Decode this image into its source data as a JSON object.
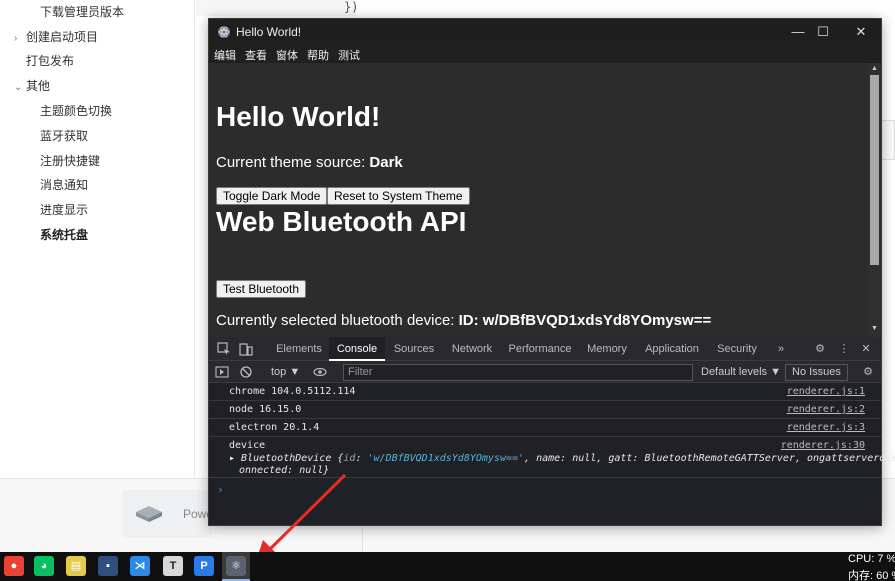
{
  "background": {
    "sidebar_items": [
      {
        "label": "下载管理员版本",
        "indent": 2,
        "caret": ""
      },
      {
        "label": "创建启动项目",
        "indent": 1,
        "caret": "›"
      },
      {
        "label": "打包发布",
        "indent": 1,
        "caret": ""
      },
      {
        "label": "其他",
        "indent": 1,
        "caret": "⌄"
      },
      {
        "label": "主题颜色切换",
        "indent": 2,
        "caret": ""
      },
      {
        "label": "蓝牙获取",
        "indent": 2,
        "caret": ""
      },
      {
        "label": "注册快捷键",
        "indent": 2,
        "caret": ""
      },
      {
        "label": "消息通知",
        "indent": 2,
        "caret": ""
      },
      {
        "label": "进度显示",
        "indent": 2,
        "caret": ""
      },
      {
        "label": "系统托盘",
        "indent": 2,
        "caret": "",
        "bold": true
      }
    ],
    "code_snippet": "})",
    "power_label": "Powe"
  },
  "window": {
    "title": "Hello World!",
    "controls": {
      "minimize": "—",
      "maximize": "☐",
      "close": "✕"
    },
    "menu": [
      "编辑",
      "查看",
      "窗体",
      "帮助",
      "测试"
    ],
    "content": {
      "heading1": "Hello World!",
      "theme_source_label": "Current theme source: ",
      "theme_source_value": "Dark",
      "toggle_button": "Toggle Dark Mode",
      "reset_button": "Reset to System Theme",
      "heading2": "Web Bluetooth API",
      "test_button": "Test Bluetooth",
      "device_label": "Currently selected bluetooth device: ",
      "device_value": "ID: w/DBfBVQD1xdsYd8YOmysw=="
    }
  },
  "devtools": {
    "tabs": [
      "Elements",
      "Console",
      "Sources",
      "Network",
      "Performance",
      "Memory",
      "Application",
      "Security"
    ],
    "active_tab": "Console",
    "more": "»",
    "context": "top ▼",
    "filter_placeholder": "Filter",
    "levels": "Default levels ▼",
    "issues": "No Issues",
    "logs": [
      {
        "text": "chrome 104.0.5112.114",
        "source": "renderer.js:1"
      },
      {
        "text": "node 16.15.0",
        "source": "renderer.js:2"
      },
      {
        "text": "electron 20.1.4",
        "source": "renderer.js:3"
      },
      {
        "text": "device",
        "source": "renderer.js:30"
      }
    ],
    "object": {
      "type": "BluetoothDevice",
      "id_key": "id",
      "id_value": "'w/DBfBVQD1xdsYd8YOmysw=='",
      "rest_line1": ", name: null, gatt: BluetoothRemoteGATTServer, ongattserverdisc",
      "rest_line2": "onnected: null}"
    },
    "prompt": "›"
  },
  "taskbar": {
    "apps": [
      {
        "name": "chrome-icon",
        "color": "#ea4335",
        "glyph": "●"
      },
      {
        "name": "wechat-icon",
        "color": "#07c160",
        "glyph": "◕"
      },
      {
        "name": "notepad-icon",
        "color": "#e6c84a",
        "glyph": "▤"
      },
      {
        "name": "app-icon",
        "color": "#2f4f7f",
        "glyph": "▪"
      },
      {
        "name": "vscode-icon",
        "color": "#2b8ae6",
        "glyph": "⋊"
      },
      {
        "name": "typora-icon",
        "color": "#d8d8d8",
        "glyph": "T"
      },
      {
        "name": "p-app-icon",
        "color": "#2c7ae8",
        "glyph": "P"
      },
      {
        "name": "electron-icon",
        "color": "#5c6370",
        "glyph": "⚛"
      }
    ],
    "cpu": "CPU: 7 %",
    "memory": "内存: 60 %"
  }
}
